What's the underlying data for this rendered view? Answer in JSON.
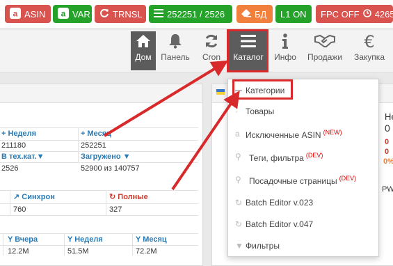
{
  "toolbar": {
    "asin": "ASIN",
    "var": "VAR",
    "trnsl": "TRNSL",
    "counter": "252251 / 2526",
    "bd": "БД",
    "l1": "L1 ON",
    "fpc": "FPC OFF",
    "fpc_count": "4265"
  },
  "nav": {
    "home": "Дом",
    "panel": "Панель",
    "cron": "Cron",
    "catalog": "Каталог",
    "info": "Инфо",
    "sales": "Продажи",
    "purchase": "Закупка"
  },
  "left": {
    "week_header": "Неделя",
    "month_header": "Месяц",
    "week_value": "211180",
    "month_value": "252251",
    "techcat_label": "В тех.кат.",
    "loaded_label": "Загружено",
    "techcat_value": "2526",
    "loaded_value": "52900 из 140757",
    "sync_label": "Синхрон",
    "full_label": "Полные",
    "sync_value": "760",
    "full_value": "327",
    "yesterday_label": "Вчера",
    "week2_label": "Неделя",
    "month2_label": "Месяц",
    "yesterday_value": "12.2M",
    "week2_value": "51.5M",
    "month2_value": "72.2M"
  },
  "right": {
    "col_label": "Не",
    "c1": "0",
    "c2": "0",
    "c3": "0",
    "c4": "0%",
    "pw_label": "PW"
  },
  "menu": {
    "items": [
      {
        "label": "Категории",
        "tag": ""
      },
      {
        "label": "Товары",
        "tag": ""
      },
      {
        "label": "Исключенные ASIN",
        "tag": "(NEW)"
      },
      {
        "label": "Теги, фильтра",
        "tag": "(DEV)"
      },
      {
        "label": "Посадочные страницы",
        "tag": "(DEV)"
      },
      {
        "label": "Batch Editor v.023",
        "tag": ""
      },
      {
        "label": "Batch Editor v.047",
        "tag": ""
      },
      {
        "label": "Фильтры",
        "tag": ""
      }
    ]
  },
  "colors": {
    "red": "#d9534f",
    "green": "#25a22a",
    "orange": "#f0803c",
    "dark": "#5c5c5c",
    "annotation": "#d82a2a"
  }
}
